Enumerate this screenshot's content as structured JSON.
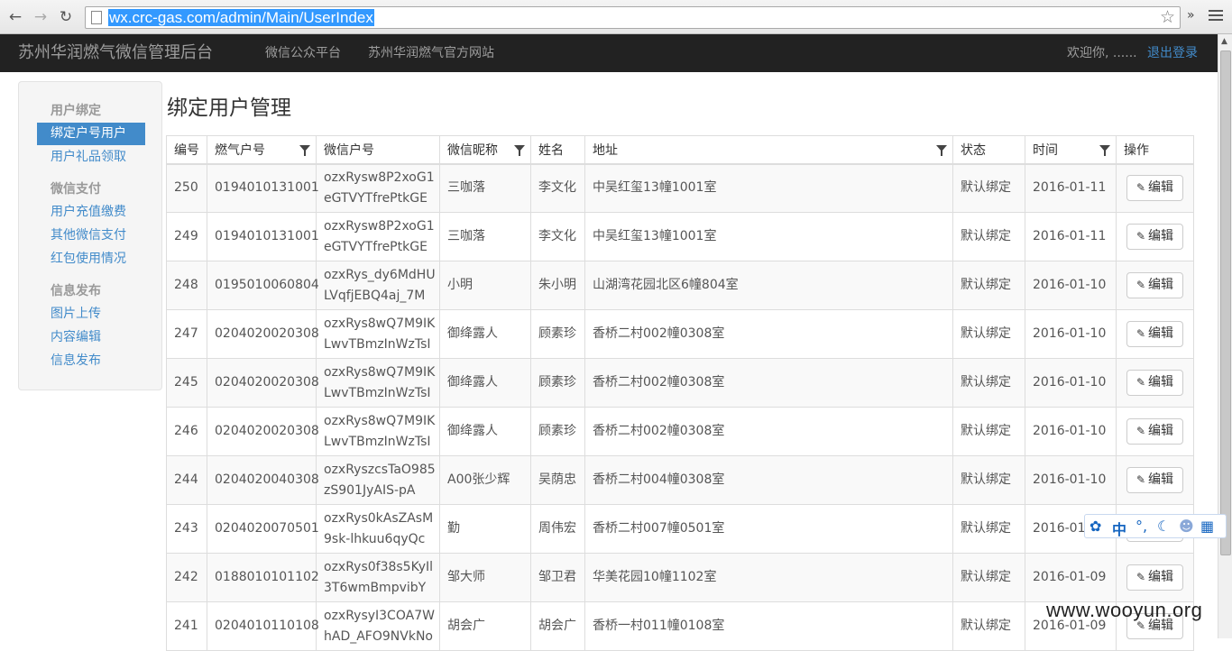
{
  "browser": {
    "url": "wx.crc-gas.com/admin/Main/UserIndex"
  },
  "navbar": {
    "brand": "苏州华润燃气微信管理后台",
    "links": [
      "微信公众平台",
      "苏州华润燃气官方网站"
    ],
    "welcome": "欢迎你, ......",
    "logout": "退出登录"
  },
  "sidebar": {
    "groups": [
      {
        "heading": "用户绑定",
        "items": [
          "绑定户号用户",
          "用户礼品领取"
        ]
      },
      {
        "heading": "微信支付",
        "items": [
          "用户充值缴费",
          "其他微信支付",
          "红包使用情况"
        ]
      },
      {
        "heading": "信息发布",
        "items": [
          "图片上传",
          "内容编辑",
          "信息发布"
        ]
      }
    ],
    "active_item": "绑定户号用户"
  },
  "page": {
    "title": "绑定用户管理"
  },
  "table": {
    "columns": [
      "编号",
      "燃气户号",
      "微信户号",
      "微信昵称",
      "姓名",
      "地址",
      "状态",
      "时间",
      "操作"
    ],
    "filter_columns": [
      "燃气户号",
      "微信昵称",
      "地址",
      "时间"
    ],
    "edit_label": "编辑",
    "rows": [
      {
        "id": "250",
        "gas": "0194010131001",
        "wx1": "ozxRysw8P2xoG1",
        "wx2": "eGTVYTfrePtkGE",
        "nick": "三咖落",
        "name": "李文化",
        "addr": "中吴红玺13幢1001室",
        "status": "默认绑定",
        "time": "2016-01-11"
      },
      {
        "id": "249",
        "gas": "0194010131001",
        "wx1": "ozxRysw8P2xoG1",
        "wx2": "eGTVYTfrePtkGE",
        "nick": "三咖落",
        "name": "李文化",
        "addr": "中吴红玺13幢1001室",
        "status": "默认绑定",
        "time": "2016-01-11"
      },
      {
        "id": "248",
        "gas": "0195010060804",
        "wx1": "ozxRys_dy6MdHU",
        "wx2": "LVqfjEBQ4aj_7M",
        "nick": "小明",
        "name": "朱小明",
        "addr": "山湖湾花园北区6幢804室",
        "status": "默认绑定",
        "time": "2016-01-10"
      },
      {
        "id": "247",
        "gas": "0204020020308",
        "wx1": "ozxRys8wQ7M9IK",
        "wx2": "LwvTBmzInWzTsI",
        "nick": "御绛露人",
        "name": "顾素珍",
        "addr": "香桥二村002幢0308室",
        "status": "默认绑定",
        "time": "2016-01-10"
      },
      {
        "id": "245",
        "gas": "0204020020308",
        "wx1": "ozxRys8wQ7M9IK",
        "wx2": "LwvTBmzInWzTsI",
        "nick": "御绛露人",
        "name": "顾素珍",
        "addr": "香桥二村002幢0308室",
        "status": "默认绑定",
        "time": "2016-01-10"
      },
      {
        "id": "246",
        "gas": "0204020020308",
        "wx1": "ozxRys8wQ7M9IK",
        "wx2": "LwvTBmzInWzTsI",
        "nick": "御绛露人",
        "name": "顾素珍",
        "addr": "香桥二村002幢0308室",
        "status": "默认绑定",
        "time": "2016-01-10"
      },
      {
        "id": "244",
        "gas": "0204020040308",
        "wx1": "ozxRyszcsTaO985",
        "wx2": "zS901JyAIS-pA",
        "nick": "A00张少辉",
        "name": "吴荫忠",
        "addr": "香桥二村004幢0308室",
        "status": "默认绑定",
        "time": "2016-01-10"
      },
      {
        "id": "243",
        "gas": "0204020070501",
        "wx1": "ozxRys0kAsZAsM",
        "wx2": "9sk-lhkuu6qyQc",
        "nick": "勤",
        "name": "周伟宏",
        "addr": "香桥二村007幢0501室",
        "status": "默认绑定",
        "time": "2016-01-"
      },
      {
        "id": "242",
        "gas": "0188010101102",
        "wx1": "ozxRys0f38s5KyIl",
        "wx2": "3T6wmBmpvibY",
        "nick": "邹大师",
        "name": "邹卫君",
        "addr": "华美花园10幢1102室",
        "status": "默认绑定",
        "time": "2016-01-09"
      },
      {
        "id": "241",
        "gas": "0204010110108",
        "wx1": "ozxRysyI3COA7W",
        "wx2": "hAD_AFO9NVkNo",
        "nick": "胡会广",
        "name": "胡会广",
        "addr": "香桥一村011幢0108室",
        "status": "默认绑定",
        "time": "2016-01-09"
      }
    ]
  },
  "ime": {
    "icons": [
      "paw-icon",
      "zh-icon",
      "punct-icon",
      "moon-icon",
      "user-icon",
      "grid-icon"
    ],
    "zh_label": "中",
    "punct_label": "°,"
  },
  "watermark": "www.wooyun.org",
  "colors": {
    "navbar_bg": "#222222",
    "accent": "#428bca",
    "url_highlight": "#3399ff"
  }
}
